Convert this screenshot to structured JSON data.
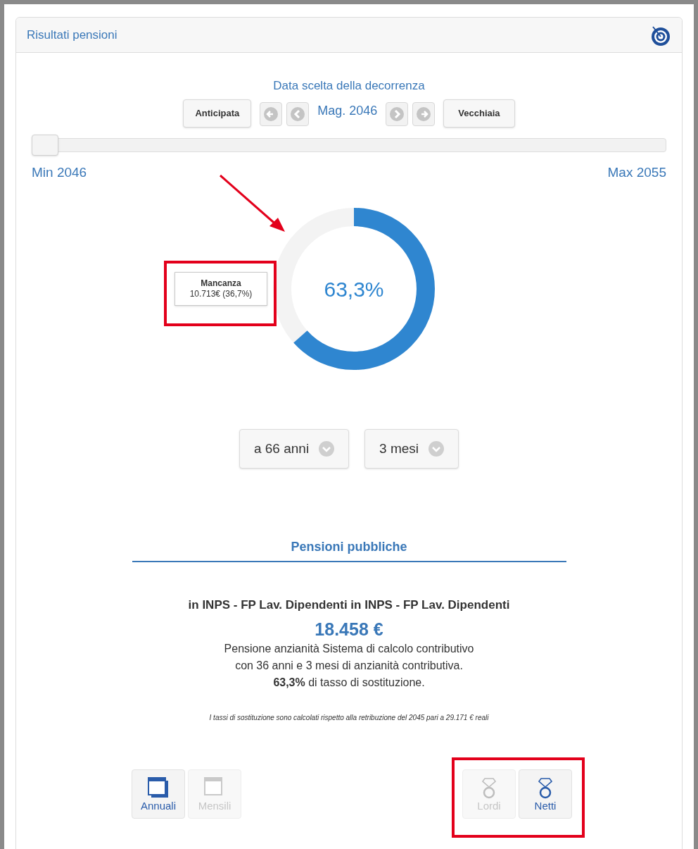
{
  "panel": {
    "title": "Risultati pensioni"
  },
  "decorrenza": {
    "label": "Data scelta della decorrenza",
    "date": "Mag. 2046",
    "buttons": [
      {
        "label": "Anticipata"
      },
      {
        "label": "Vecchiaia"
      }
    ]
  },
  "slider": {
    "level": 0,
    "min_label": "Min 2046",
    "max_label": "Max 2055"
  },
  "gauge": {
    "value_label": "63,3%"
  },
  "shortfall": {
    "title": "Mancanza",
    "value": "10.713€ (36,7%)"
  },
  "dropdowns": [
    {
      "value": "a 66 anni"
    },
    {
      "value": "3 mesi"
    }
  ],
  "section": {
    "title": "Pensioni pubbliche",
    "fund": "in INPS - FP Lav. Dipendenti in INPS - FP Lav. Dipendenti",
    "amount": "18.458 €",
    "lines": [
      "Pensione anzianità Sistema di calcolo contributivo",
      "con 36 anni e 3 mesi di anzianità contributiva.",
      "**63,3%** di tasso di sostituzione."
    ],
    "footnote": "I tassi di sostituzione sono calcolati rispetto alla retribuzione del 2045 pari a 29.171 € reali"
  },
  "period_toggle": [
    {
      "label": "Annuali",
      "selected": true
    },
    {
      "label": "Mensili",
      "selected": false
    }
  ],
  "amount_toggle": [
    {
      "label": "Lordi",
      "selected": false
    },
    {
      "label": "Netti",
      "selected": true
    }
  ]
}
